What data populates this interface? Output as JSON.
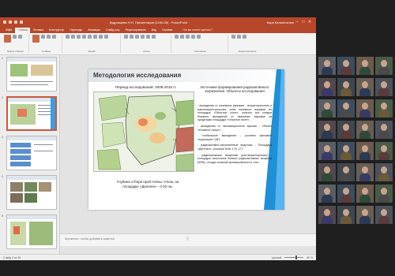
{
  "window": {
    "title": "Кудрявцева Н.Н. Презентация (1190-08) - PowerPoint",
    "user": "Кира Калиниченко",
    "minimize_glyph": "–",
    "maximize_glyph": "□",
    "close_glyph": "✕"
  },
  "ribbon": {
    "tabs": [
      "Файл",
      "Главная",
      "Вставка",
      "Конструктор",
      "Переходы",
      "Анимация",
      "Слайд-шоу",
      "Рецензирование",
      "Вид",
      "Справка"
    ],
    "active_tab": "Главная",
    "search_placeholder": "Что вы хотите сделать?",
    "groups": [
      "Буфер обмена",
      "Слайды",
      "Шрифт",
      "Абзац",
      "Рисование",
      "Редактирование"
    ]
  },
  "thumbnails": [
    {
      "num": "1"
    },
    {
      "num": "2"
    },
    {
      "num": "3"
    },
    {
      "num": "4"
    },
    {
      "num": "5"
    }
  ],
  "slide": {
    "title": "Методология исследования",
    "period": "Период исследований: 2008-2016 гг.",
    "map_caption": "Глубина отбора проб почвы: 0-5см, на площадке «Дегелен» - 0-20 см.",
    "sources_title": "Источники формирования радиоактивного загрязнения. Объекты исследования",
    "sources": [
      "- выпадения от наземных взрывов - эпицентральные и ижнеэпицентральные зоны наземных взрывов на площадке «Опытное поле», участок зон следов ближних выпадений от наземных взрывов за пределами площадки «Опытное поле»;",
      "- выпадения от экскавационного взрыва - Объект «Атомное озеро»;",
      "- глобальные выпадения - условно фоновые территории СИП;",
      "- радиоактивно-загрязненные водотоки - Площадка «Дегелен», штольни №№ 176, 177;",
      "- радиоактивные вещества (растворы/порошки) - площадки испытания боевых радиоактивных веществ (БРВ), отходы атомной промышленности «4а»."
    ]
  },
  "notes": {
    "placeholder": "Щелкните, чтобы добавить заметки"
  },
  "status": {
    "slide_info": "Слайд 2 из 15",
    "language": "русский",
    "zoom": "69 %"
  },
  "participants": {
    "count_visible": 32
  },
  "colors": {
    "accent": "#b7472a",
    "slide_decor": "#1f8fd6",
    "call_background": "#1f1f1f"
  }
}
